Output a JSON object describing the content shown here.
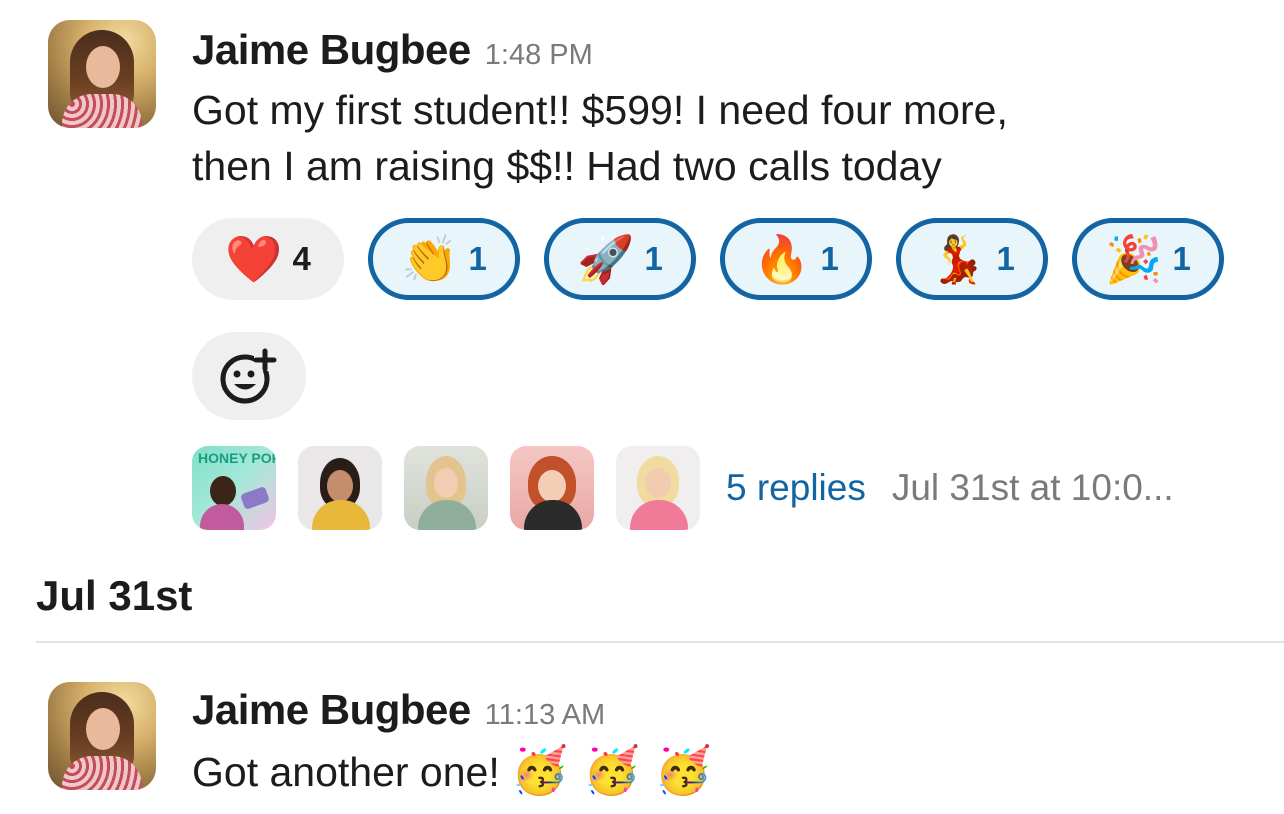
{
  "messages": [
    {
      "author": "Jaime Bugbee",
      "time": "1:48 PM",
      "text_line1": "Got my first student!! $599! I need four more,",
      "text_line2": "then I am raising $$!! Had two calls today",
      "reactions": [
        {
          "emoji": "❤️",
          "name": "heart",
          "count": "4",
          "mine": false
        },
        {
          "emoji": "👏",
          "name": "clap",
          "count": "1",
          "mine": true
        },
        {
          "emoji": "🚀",
          "name": "rocket",
          "count": "1",
          "mine": true
        },
        {
          "emoji": "🔥",
          "name": "fire",
          "count": "1",
          "mine": true
        },
        {
          "emoji": "💃",
          "name": "dancer",
          "count": "1",
          "mine": true
        },
        {
          "emoji": "🎉",
          "name": "tada",
          "count": "1",
          "mine": true
        }
      ],
      "add_reaction_icon": "add-reaction-icon",
      "thread": {
        "replies": "5 replies",
        "last_reply": "Jul 31st at 10:0...",
        "reply_avatar_logo_text": "HONEY POP"
      }
    },
    {
      "author": "Jaime Bugbee",
      "time": "11:13 AM",
      "text": "Got another one!",
      "emojis": "🥳 🥳 🥳"
    }
  ],
  "date_divider": "Jul 31st",
  "colors": {
    "link": "#1264a3",
    "reaction_mine_bg": "#e8f5fb",
    "reaction_plain_bg": "#efefef",
    "timestamp": "#7a7a7a"
  }
}
